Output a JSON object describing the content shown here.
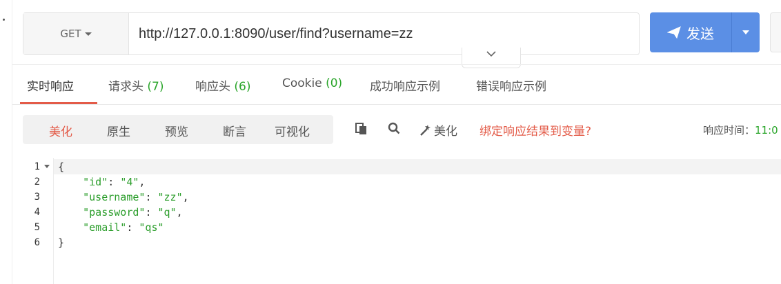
{
  "request": {
    "method": "GET",
    "url": "http://127.0.0.1:8090/user/find?username=zz",
    "send_label": "发送"
  },
  "tabs": [
    {
      "label": "实时响应",
      "count": ""
    },
    {
      "label": "请求头 ",
      "count": "(7)"
    },
    {
      "label": "响应头 ",
      "count": "(6)"
    },
    {
      "label": "Cookie ",
      "count": "(0)"
    },
    {
      "label": "成功响应示例",
      "count": ""
    },
    {
      "label": "错误响应示例",
      "count": ""
    }
  ],
  "view_modes": [
    "美化",
    "原生",
    "预览",
    "断言",
    "可视化"
  ],
  "toolbar": {
    "beautify_label": "美化",
    "bind_label": "绑定响应结果到变量?",
    "resp_time_label": "响应时间：",
    "resp_time_value": "11:0"
  },
  "response": {
    "line_numbers": [
      "1",
      "2",
      "3",
      "4",
      "5",
      "6"
    ],
    "open_brace": "{",
    "close_brace": "}",
    "fields": [
      {
        "key": "\"id\"",
        "value": "\"4\"",
        "sep": ","
      },
      {
        "key": "\"username\"",
        "value": "\"zz\"",
        "sep": ","
      },
      {
        "key": "\"password\"",
        "value": "\"q\"",
        "sep": ","
      },
      {
        "key": "\"email\"",
        "value": "\"qs\"",
        "sep": ""
      }
    ]
  },
  "colors": {
    "accent_blue": "#5b8fe5",
    "active_red": "#e35b48",
    "green": "#2aa52a"
  }
}
